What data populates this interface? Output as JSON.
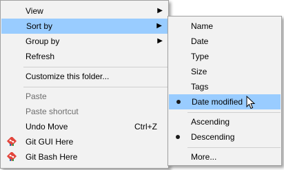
{
  "main_menu": {
    "view": "View",
    "sort_by": "Sort by",
    "group_by": "Group by",
    "refresh": "Refresh",
    "customize": "Customize this folder...",
    "paste": "Paste",
    "paste_shortcut": "Paste shortcut",
    "undo_move": "Undo Move",
    "undo_shortcut": "Ctrl+Z",
    "git_gui": "Git GUI Here",
    "git_bash": "Git Bash Here"
  },
  "sort_menu": {
    "name": "Name",
    "date": "Date",
    "type": "Type",
    "size": "Size",
    "tags": "Tags",
    "date_modified": "Date modified",
    "ascending": "Ascending",
    "descending": "Descending",
    "more": "More..."
  },
  "state": {
    "sort_field": "Date modified",
    "sort_order": "Descending"
  },
  "colors": {
    "highlight": "#99ccff",
    "menu_bg": "#f2f2f2",
    "disabled_text": "#6d6d6d",
    "git_icon": "#e2453c"
  },
  "icons": {
    "submenu_arrow": "chevron-right-icon",
    "git": "git-icon",
    "selected": "radio-bullet-icon",
    "cursor": "mouse-pointer-icon"
  }
}
